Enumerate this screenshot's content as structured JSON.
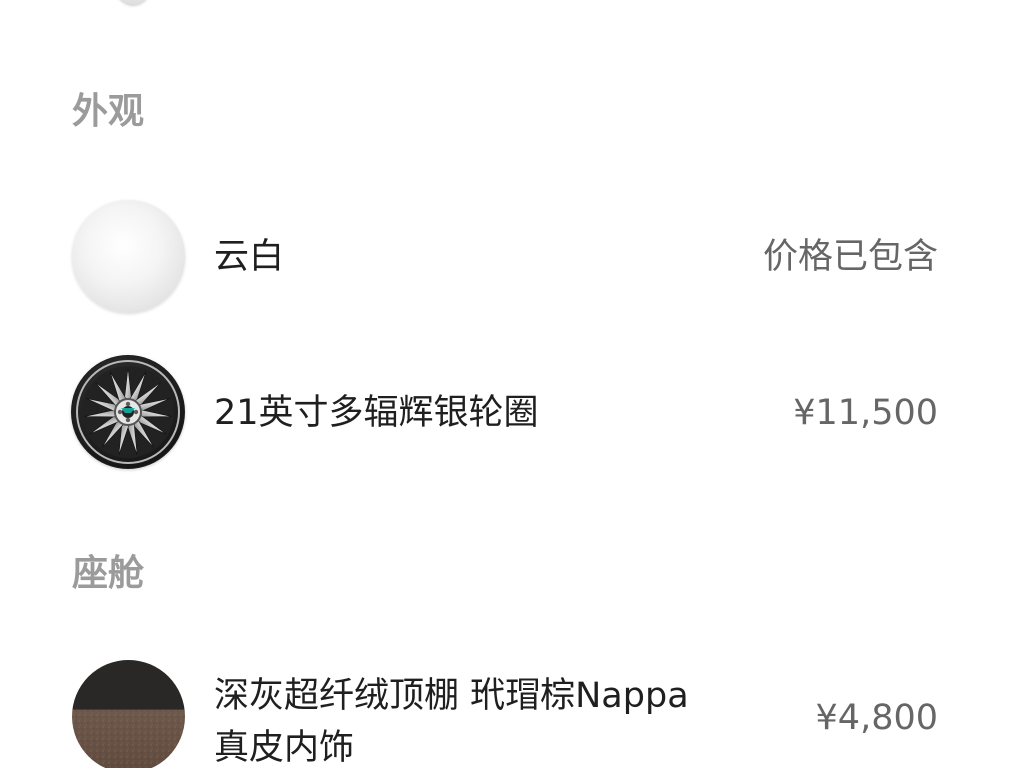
{
  "sections": {
    "exterior": {
      "title": "外观",
      "items": [
        {
          "name": "云白",
          "price": "价格已包含"
        },
        {
          "name": "21英寸多辐辉银轮圈",
          "price": "¥11,500"
        }
      ]
    },
    "cabin": {
      "title": "座舱",
      "items": [
        {
          "name_line1": "深灰超纤绒顶棚 玳瑁棕Nappa",
          "name_line2": "真皮内饰",
          "price": "¥4,800"
        }
      ]
    }
  },
  "colors": {
    "section_title": "#9b9b9b",
    "item_text": "#1f1f1f",
    "price_text": "#666666",
    "background": "#ffffff",
    "cloud_white": "#f2f2f2",
    "wheel_dark": "#1e1e1e",
    "wheel_silver": "#d7d7d7",
    "headliner_gray": "#2a2927",
    "leather_brown": "#6e594c"
  },
  "icons": {
    "top_swatch": "partial-option-swatch-icon",
    "cloud_white": "cloud-white-color-swatch-icon",
    "wheel": "multi-spoke-silver-wheel-icon",
    "cabin": "gray-brown-interior-swatch-icon"
  }
}
